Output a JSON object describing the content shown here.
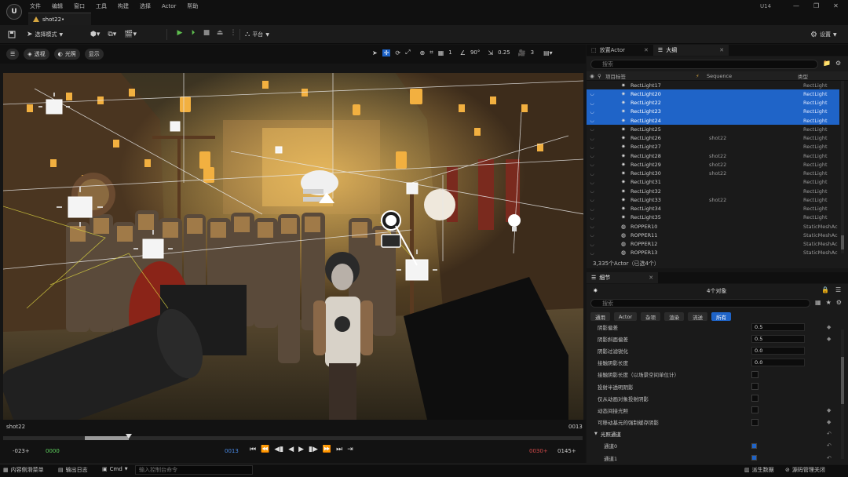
{
  "titlebar": {
    "logo": "U",
    "menu": [
      "文件",
      "编辑",
      "窗口",
      "工具",
      "构建",
      "选择",
      "Actor",
      "帮助"
    ],
    "document_tab": "shot22•",
    "project": "U14",
    "window_controls": [
      "—",
      "❐",
      "✕"
    ]
  },
  "toolbar": {
    "mode_label": "选择模式",
    "platform_label": "平台",
    "settings_label": "设置"
  },
  "viewport": {
    "buttons": [
      "透视",
      "光照",
      "显示"
    ],
    "fov": "90°",
    "speed": "0.25",
    "grid": "1",
    "camera_speed": "3",
    "shot_name": "shot22",
    "shot_frame": "0013"
  },
  "timeline": {
    "start": "-023+",
    "green_mark": "0000",
    "current": "0013",
    "red_mark": "0030+",
    "end": "0145+",
    "progress": 0.2
  },
  "statusbar": {
    "content_drawer": "内容侧滑菜单",
    "output_log": "输出日志",
    "cmd": "Cmd",
    "console_placeholder": "输入控制台命令",
    "derive_data": "派生数据",
    "source_control": "源码管理关闭"
  },
  "panels": {
    "place_actors_tab": "放置Actor",
    "outliner_tab": "大纲",
    "details_tab": "细节"
  },
  "outliner": {
    "search_placeholder": "搜索",
    "columns": {
      "label": "项目标签",
      "sequence": "Sequence",
      "type": "类型"
    },
    "rows": [
      {
        "name": "RectLight17",
        "seq": "",
        "type": "RectLight",
        "sel": false,
        "eye": false
      },
      {
        "name": "RectLight20",
        "seq": "",
        "type": "RectLight",
        "sel": true,
        "eye": true
      },
      {
        "name": "RectLight22",
        "seq": "",
        "type": "RectLight",
        "sel": true,
        "eye": true
      },
      {
        "name": "RectLight23",
        "seq": "",
        "type": "RectLight",
        "sel": true,
        "eye": true
      },
      {
        "name": "RectLight24",
        "seq": "",
        "type": "RectLight",
        "sel": true,
        "eye": true
      },
      {
        "name": "RectLight25",
        "seq": "",
        "type": "RectLight",
        "sel": false,
        "eye": true
      },
      {
        "name": "RectLight26",
        "seq": "shot22",
        "type": "RectLight",
        "sel": false,
        "eye": true
      },
      {
        "name": "RectLight27",
        "seq": "",
        "type": "RectLight",
        "sel": false,
        "eye": true
      },
      {
        "name": "RectLight28",
        "seq": "shot22",
        "type": "RectLight",
        "sel": false,
        "eye": true
      },
      {
        "name": "RectLight29",
        "seq": "shot22",
        "type": "RectLight",
        "sel": false,
        "eye": true
      },
      {
        "name": "RectLight30",
        "seq": "shot22",
        "type": "RectLight",
        "sel": false,
        "eye": true
      },
      {
        "name": "RectLight31",
        "seq": "",
        "type": "RectLight",
        "sel": false,
        "eye": true
      },
      {
        "name": "RectLight32",
        "seq": "",
        "type": "RectLight",
        "sel": false,
        "eye": true
      },
      {
        "name": "RectLight33",
        "seq": "shot22",
        "type": "RectLight",
        "sel": false,
        "eye": true
      },
      {
        "name": "RectLight34",
        "seq": "",
        "type": "RectLight",
        "sel": false,
        "eye": true
      },
      {
        "name": "RectLight35",
        "seq": "",
        "type": "RectLight",
        "sel": false,
        "eye": true
      },
      {
        "name": "ROPPER10",
        "seq": "",
        "type": "StaticMeshAc",
        "sel": false,
        "eye": true
      },
      {
        "name": "ROPPER11",
        "seq": "",
        "type": "StaticMeshAc",
        "sel": false,
        "eye": true
      },
      {
        "name": "ROPPER12",
        "seq": "",
        "type": "StaticMeshAc",
        "sel": false,
        "eye": true
      },
      {
        "name": "ROPPER13",
        "seq": "",
        "type": "StaticMeshAc",
        "sel": false,
        "eye": true
      }
    ],
    "count": "3,335个Actor（已选4个）"
  },
  "details": {
    "title": "4个对象",
    "search_placeholder": "搜索",
    "filters": [
      "通用",
      "Actor",
      "杂项",
      "渲染",
      "流送",
      "所有"
    ],
    "active_filter": 5,
    "rows": [
      {
        "label": "阴影偏差",
        "kind": "value",
        "value": "0.5",
        "reset": true
      },
      {
        "label": "阴影斜面偏差",
        "kind": "value",
        "value": "0.5",
        "reset": true
      },
      {
        "label": "阴影过滤锐化",
        "kind": "value",
        "value": "0.0",
        "reset": false
      },
      {
        "label": "接触阴影长度",
        "kind": "value",
        "value": "0.0",
        "reset": false
      },
      {
        "label": "接触阴影长度（以场景空间单位计）",
        "kind": "check",
        "value": "",
        "reset": false
      },
      {
        "label": "投射半透明阴影",
        "kind": "check",
        "value": "",
        "reset": false
      },
      {
        "label": "仅从动画对象投射阴影",
        "kind": "check",
        "value": "",
        "reset": false
      },
      {
        "label": "动态间接光照",
        "kind": "check",
        "value": "",
        "reset": true
      },
      {
        "label": "可移动基元的强制缓存阴影",
        "kind": "check",
        "value": "",
        "reset": true
      },
      {
        "label": "光照通道",
        "kind": "section",
        "value": "",
        "reset": true
      },
      {
        "label": "通道0",
        "kind": "channel",
        "value": "",
        "reset": true
      },
      {
        "label": "通道1",
        "kind": "channel",
        "value": "",
        "reset": true
      }
    ]
  },
  "colors": {
    "selection": "#1f64c8",
    "play": "#5fbf4f",
    "accent_gold": "#d6a640"
  }
}
